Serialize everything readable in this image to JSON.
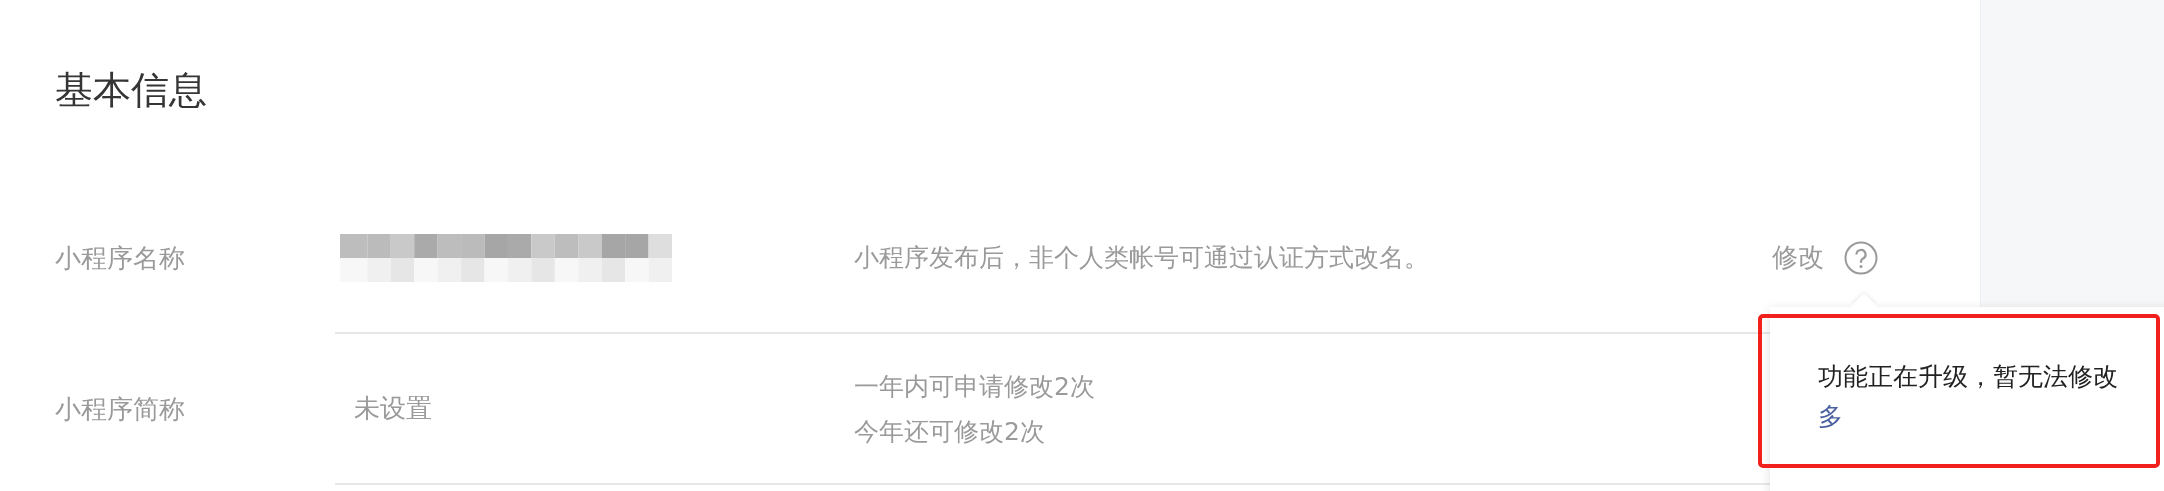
{
  "section_title": "基本信息",
  "rows": [
    {
      "label": "小程序名称",
      "value": {
        "kind": "picture"
      },
      "description": [
        "小程序发布后，非个人类帐号可通过认证方式改名。"
      ],
      "action": {
        "label": "修改",
        "help": true
      }
    },
    {
      "label": "小程序简称",
      "value": {
        "kind": "text",
        "text": "未设置"
      },
      "description": [
        "一年内可申请修改2次",
        "今年还可修改2次"
      ]
    }
  ],
  "tooltip": {
    "message": "功能正在升级，暂无法修改",
    "link": "多",
    "highlighted": true
  }
}
